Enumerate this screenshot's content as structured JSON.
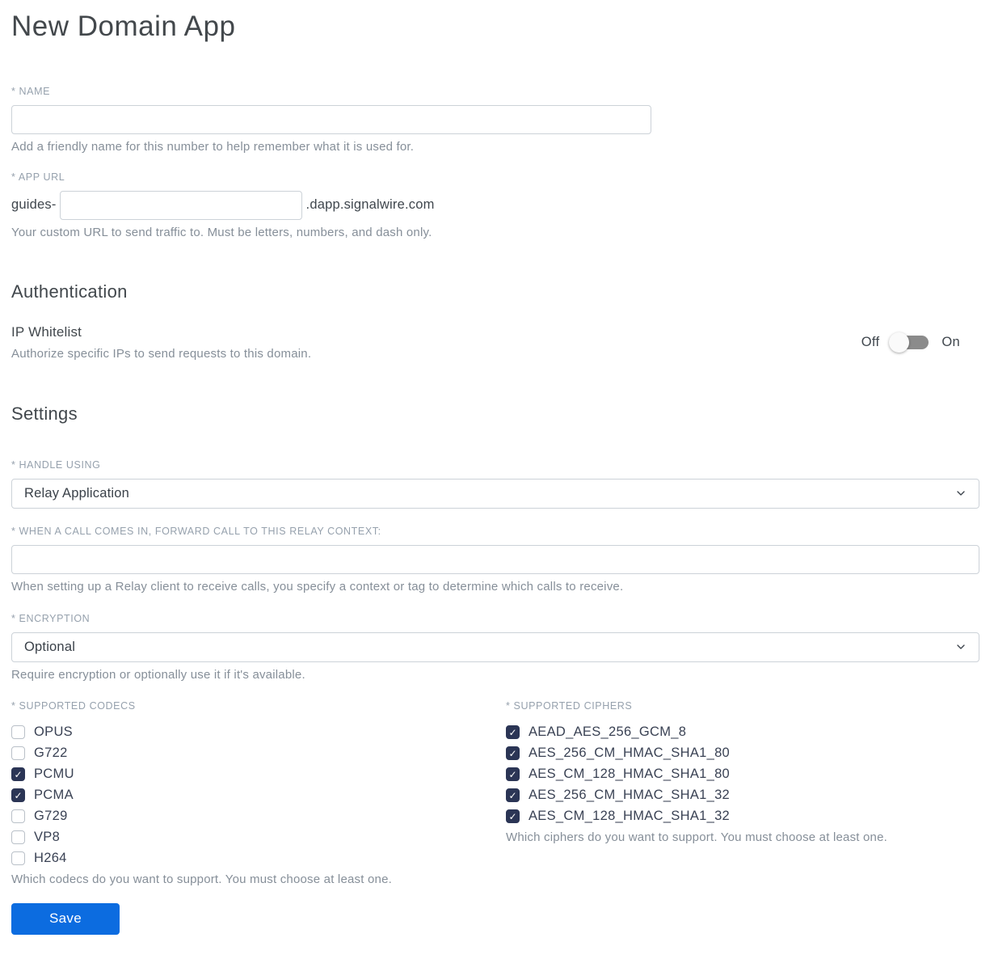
{
  "page": {
    "title": "New Domain App"
  },
  "colors": {
    "accent_blue": "#0c6ce0",
    "checkbox_checked": "#2b3555",
    "label_gray": "#96a1ad",
    "helper_gray": "#868f99",
    "text_dark": "#3f464d",
    "input_border": "#ccd2d8",
    "toggle_track_gray": "#8b8b8b"
  },
  "name_field": {
    "label": "* Name",
    "value": "",
    "helper": "Add a friendly name for this number to help remember what it is used for."
  },
  "app_url_field": {
    "label": "* App URL",
    "prefix": "guides-",
    "value": "",
    "suffix": ".dapp.signalwire.com",
    "helper": "Your custom URL to send traffic to. Must be letters, numbers, and dash only."
  },
  "authentication": {
    "heading": "Authentication",
    "ip_whitelist": {
      "label": "IP Whitelist",
      "helper": "Authorize specific IPs to send requests to this domain.",
      "toggle_off_label": "Off",
      "toggle_on_label": "On",
      "state": "off"
    }
  },
  "settings": {
    "heading": "Settings",
    "handle_using": {
      "label": "* Handle using",
      "selected": "Relay Application"
    },
    "relay_context": {
      "label": "* When a call comes in, forward call to this relay context:",
      "value": "",
      "helper": "When setting up a Relay client to receive calls, you specify a context or tag to determine which calls to receive."
    },
    "encryption": {
      "label": "* Encryption",
      "selected": "Optional",
      "helper": "Require encryption or optionally use it if it's available."
    },
    "codecs": {
      "label": "* Supported Codecs",
      "options": [
        {
          "label": "OPUS",
          "checked": false
        },
        {
          "label": "G722",
          "checked": false
        },
        {
          "label": "PCMU",
          "checked": true
        },
        {
          "label": "PCMA",
          "checked": true
        },
        {
          "label": "G729",
          "checked": false
        },
        {
          "label": "VP8",
          "checked": false
        },
        {
          "label": "H264",
          "checked": false
        }
      ],
      "helper": "Which codecs do you want to support. You must choose at least one."
    },
    "ciphers": {
      "label": "* Supported Ciphers",
      "options": [
        {
          "label": "AEAD_AES_256_GCM_8",
          "checked": true
        },
        {
          "label": "AES_256_CM_HMAC_SHA1_80",
          "checked": true
        },
        {
          "label": "AES_CM_128_HMAC_SHA1_80",
          "checked": true
        },
        {
          "label": "AES_256_CM_HMAC_SHA1_32",
          "checked": true
        },
        {
          "label": "AES_CM_128_HMAC_SHA1_32",
          "checked": true
        }
      ],
      "helper": "Which ciphers do you want to support. You must choose at least one."
    }
  },
  "actions": {
    "save_label": "Save"
  }
}
